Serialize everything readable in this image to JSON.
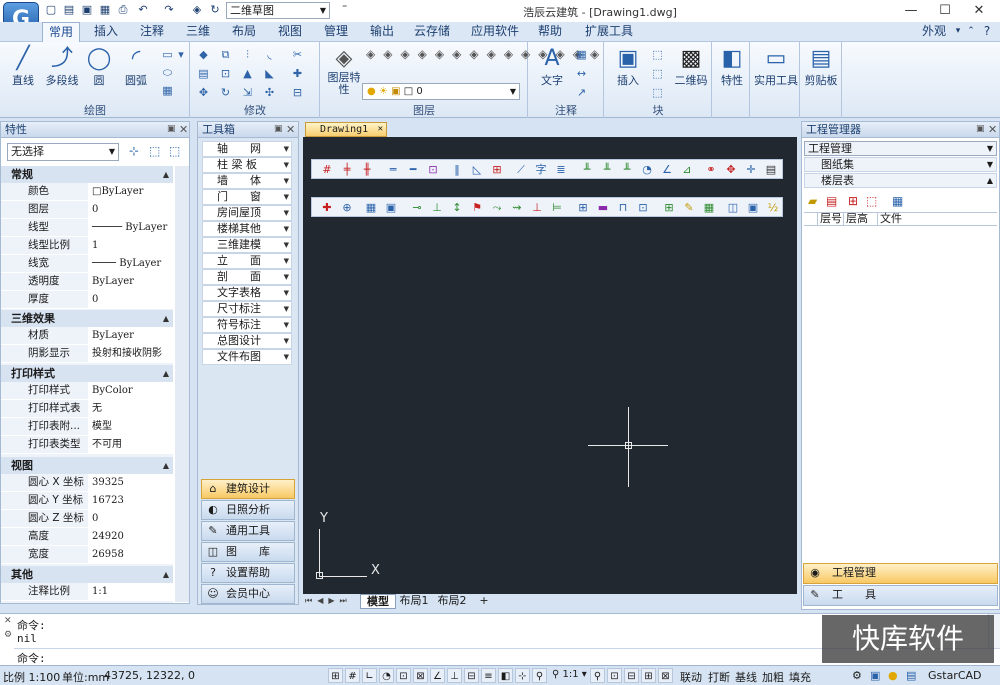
{
  "titlebar": {
    "app_title": "浩辰云建筑 - [Drawing1.dwg]",
    "view_selector": "二维草图",
    "quick_access_icons": [
      "new-icon",
      "open-icon",
      "save-icon",
      "save-as-icon",
      "print-icon",
      "undo-icon",
      "redo-icon",
      "layer-icon",
      "refresh-icon"
    ],
    "window_buttons": {
      "minimize": "—",
      "maximize": "☐",
      "close": "✕"
    },
    "logo_letter": "G"
  },
  "menu": {
    "tabs": [
      "常用",
      "插入",
      "注释",
      "三维",
      "布局",
      "视图",
      "管理",
      "输出",
      "云存储",
      "应用软件",
      "帮助",
      "扩展工具"
    ],
    "active": "常用",
    "right_label": "外观",
    "right_icons": [
      "?",
      "－",
      "□",
      "✕"
    ]
  },
  "ribbon": {
    "groups": [
      {
        "label": "绘图",
        "buttons": [
          "直线",
          "多段线",
          "圆",
          "圆弧"
        ]
      },
      {
        "label": "修改"
      },
      {
        "label": "图层",
        "buttons": [
          "图层特性"
        ],
        "layer_value": "0"
      },
      {
        "label": "注释",
        "buttons": [
          "文字"
        ]
      },
      {
        "label": "块",
        "buttons": [
          "插入",
          "二维码"
        ]
      },
      {
        "label": "",
        "buttons": [
          "特性"
        ]
      },
      {
        "label": "",
        "buttons": [
          "实用工具"
        ]
      },
      {
        "label": "",
        "buttons": [
          "剪贴板"
        ]
      }
    ]
  },
  "properties": {
    "title": "特性",
    "selection": "无选择",
    "sections": [
      {
        "name": "常规",
        "rows": [
          [
            "颜色",
            "ByLayer"
          ],
          [
            "图层",
            "0"
          ],
          [
            "线型",
            "ByLayer"
          ],
          [
            "线型比例",
            "1"
          ],
          [
            "线宽",
            "ByLayer"
          ],
          [
            "透明度",
            "ByLayer"
          ],
          [
            "厚度",
            "0"
          ]
        ]
      },
      {
        "name": "三维效果",
        "rows": [
          [
            "材质",
            "ByLayer"
          ],
          [
            "阴影显示",
            "投射和接收阴影"
          ]
        ]
      },
      {
        "name": "打印样式",
        "rows": [
          [
            "打印样式",
            "ByColor"
          ],
          [
            "打印样式表",
            "无"
          ],
          [
            "打印表附...",
            "模型"
          ],
          [
            "打印表类型",
            "不可用"
          ]
        ]
      },
      {
        "name": "视图",
        "rows": [
          [
            "圆心 X 坐标",
            "39325"
          ],
          [
            "圆心 Y 坐标",
            "16723"
          ],
          [
            "圆心 Z 坐标",
            "0"
          ],
          [
            "高度",
            "24920"
          ],
          [
            "宽度",
            "26958"
          ]
        ]
      },
      {
        "name": "其他",
        "rows": [
          [
            "注释比例",
            "1:1"
          ]
        ]
      }
    ]
  },
  "toolbox": {
    "title": "工具箱",
    "items": [
      "轴　　网",
      "柱 梁 板",
      "墙　　体",
      "门　　窗",
      "房间屋顶",
      "楼梯其他",
      "三维建模",
      "立　　面",
      "剖　　面",
      "文字表格",
      "尺寸标注",
      "符号标注",
      "总图设计",
      "文件布图"
    ],
    "bottom": [
      {
        "label": "建筑设计",
        "icon": "house-icon",
        "selected": true
      },
      {
        "label": "日照分析",
        "icon": "sun-icon",
        "selected": false
      },
      {
        "label": "通用工具",
        "icon": "tools-icon",
        "selected": false
      },
      {
        "label": "图　　库",
        "icon": "library-icon",
        "selected": false
      },
      {
        "label": "设置帮助",
        "icon": "help-icon",
        "selected": false
      },
      {
        "label": "会员中心",
        "icon": "member-icon",
        "selected": false
      }
    ]
  },
  "drawing": {
    "tab": "Drawing1",
    "ucs_x": "X",
    "ucs_y": "Y",
    "layout_tabs": [
      "模型",
      "布局1",
      "布局2",
      "+"
    ],
    "active_layout": "模型"
  },
  "manager": {
    "title": "工程管理器",
    "dropdown": "工程管理",
    "items": [
      "图纸集",
      "楼层表"
    ],
    "columns": [
      "层号",
      "层高",
      "文件"
    ],
    "bottom": [
      {
        "label": "工程管理",
        "selected": true
      },
      {
        "label": "工　　具",
        "selected": false
      }
    ]
  },
  "command": {
    "lines": [
      "命令:",
      "nil",
      "命令:"
    ]
  },
  "status": {
    "scale": "比例 1:100",
    "unit": "单位:mm",
    "coords": "43725, 12322, 0",
    "anno_scale": "1:1",
    "right_texts": [
      "联动",
      "打断",
      "基线",
      "加粗",
      "填充"
    ],
    "app_name": "GstarCAD"
  },
  "watermark": "快库软件"
}
